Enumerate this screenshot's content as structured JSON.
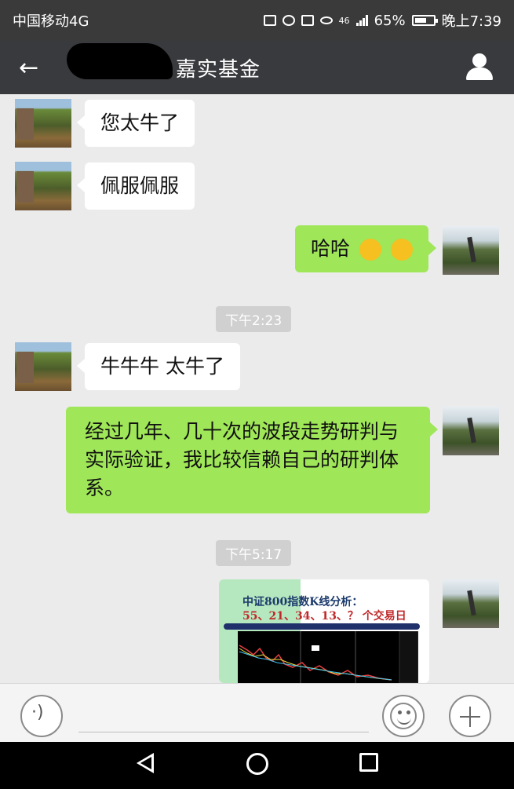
{
  "status_bar": {
    "carrier": "中国移动4G",
    "network": "46",
    "battery": "65%",
    "battery_level": 0.65,
    "time": "晚上7:39"
  },
  "header": {
    "title": "嘉实基金"
  },
  "messages": [
    {
      "side": "left",
      "text": "您太牛了"
    },
    {
      "side": "left",
      "text": "佩服佩服"
    },
    {
      "side": "right",
      "text": "哈哈"
    },
    {
      "type": "time",
      "text": "下午2:23"
    },
    {
      "side": "left",
      "text": "牛牛牛 太牛了"
    },
    {
      "side": "right",
      "text": "经过几年、几十次的波段走势研判与实际验证，我比较信赖自己的研判体系。"
    },
    {
      "type": "time",
      "text": "下午5:17"
    },
    {
      "side": "right",
      "type": "image",
      "line1": "中证800指数K线分析：",
      "line2": "55、21、34、13、？ 个交易日"
    }
  ]
}
